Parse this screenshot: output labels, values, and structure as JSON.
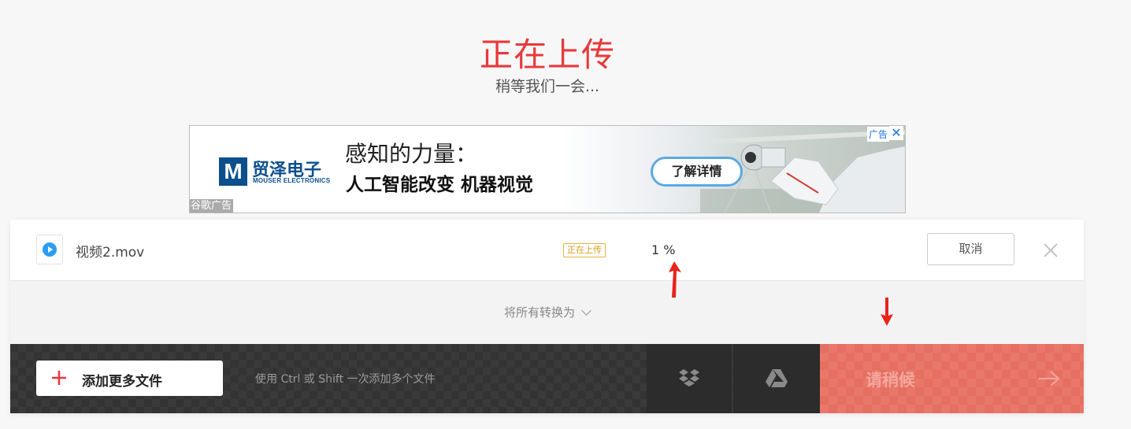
{
  "header": {
    "title": "正在上传",
    "subtitle": "稍等我们一会..."
  },
  "ad": {
    "logo_letter": "M",
    "brand": "贸泽电子",
    "brand_en": "MOUSER ELECTRONICS",
    "headline": "感知的力量：",
    "subline": "人工智能改变 机器视觉",
    "cta": "了解详情",
    "badge": "广告",
    "attribution": "谷歌广告"
  },
  "file": {
    "name": "视频2.mov",
    "status": "正在上传",
    "progress": "1 %",
    "progress_value": 1,
    "cancel_label": "取消"
  },
  "convert": {
    "label": "将所有转换为"
  },
  "actions": {
    "add_files_label": "添加更多文件",
    "hint": "使用 Ctrl 或 Shift 一次添加多个文件",
    "wait_label": "请稍候"
  },
  "colors": {
    "title_red": "#e8393b",
    "accent_red": "#e56f60",
    "status_amber": "#e8b23a",
    "play_blue": "#2b9df4"
  },
  "icons": [
    "play-icon",
    "close-icon",
    "chevron-down-icon",
    "plus-icon",
    "dropbox-icon",
    "google-drive-icon",
    "arrow-right-icon"
  ]
}
